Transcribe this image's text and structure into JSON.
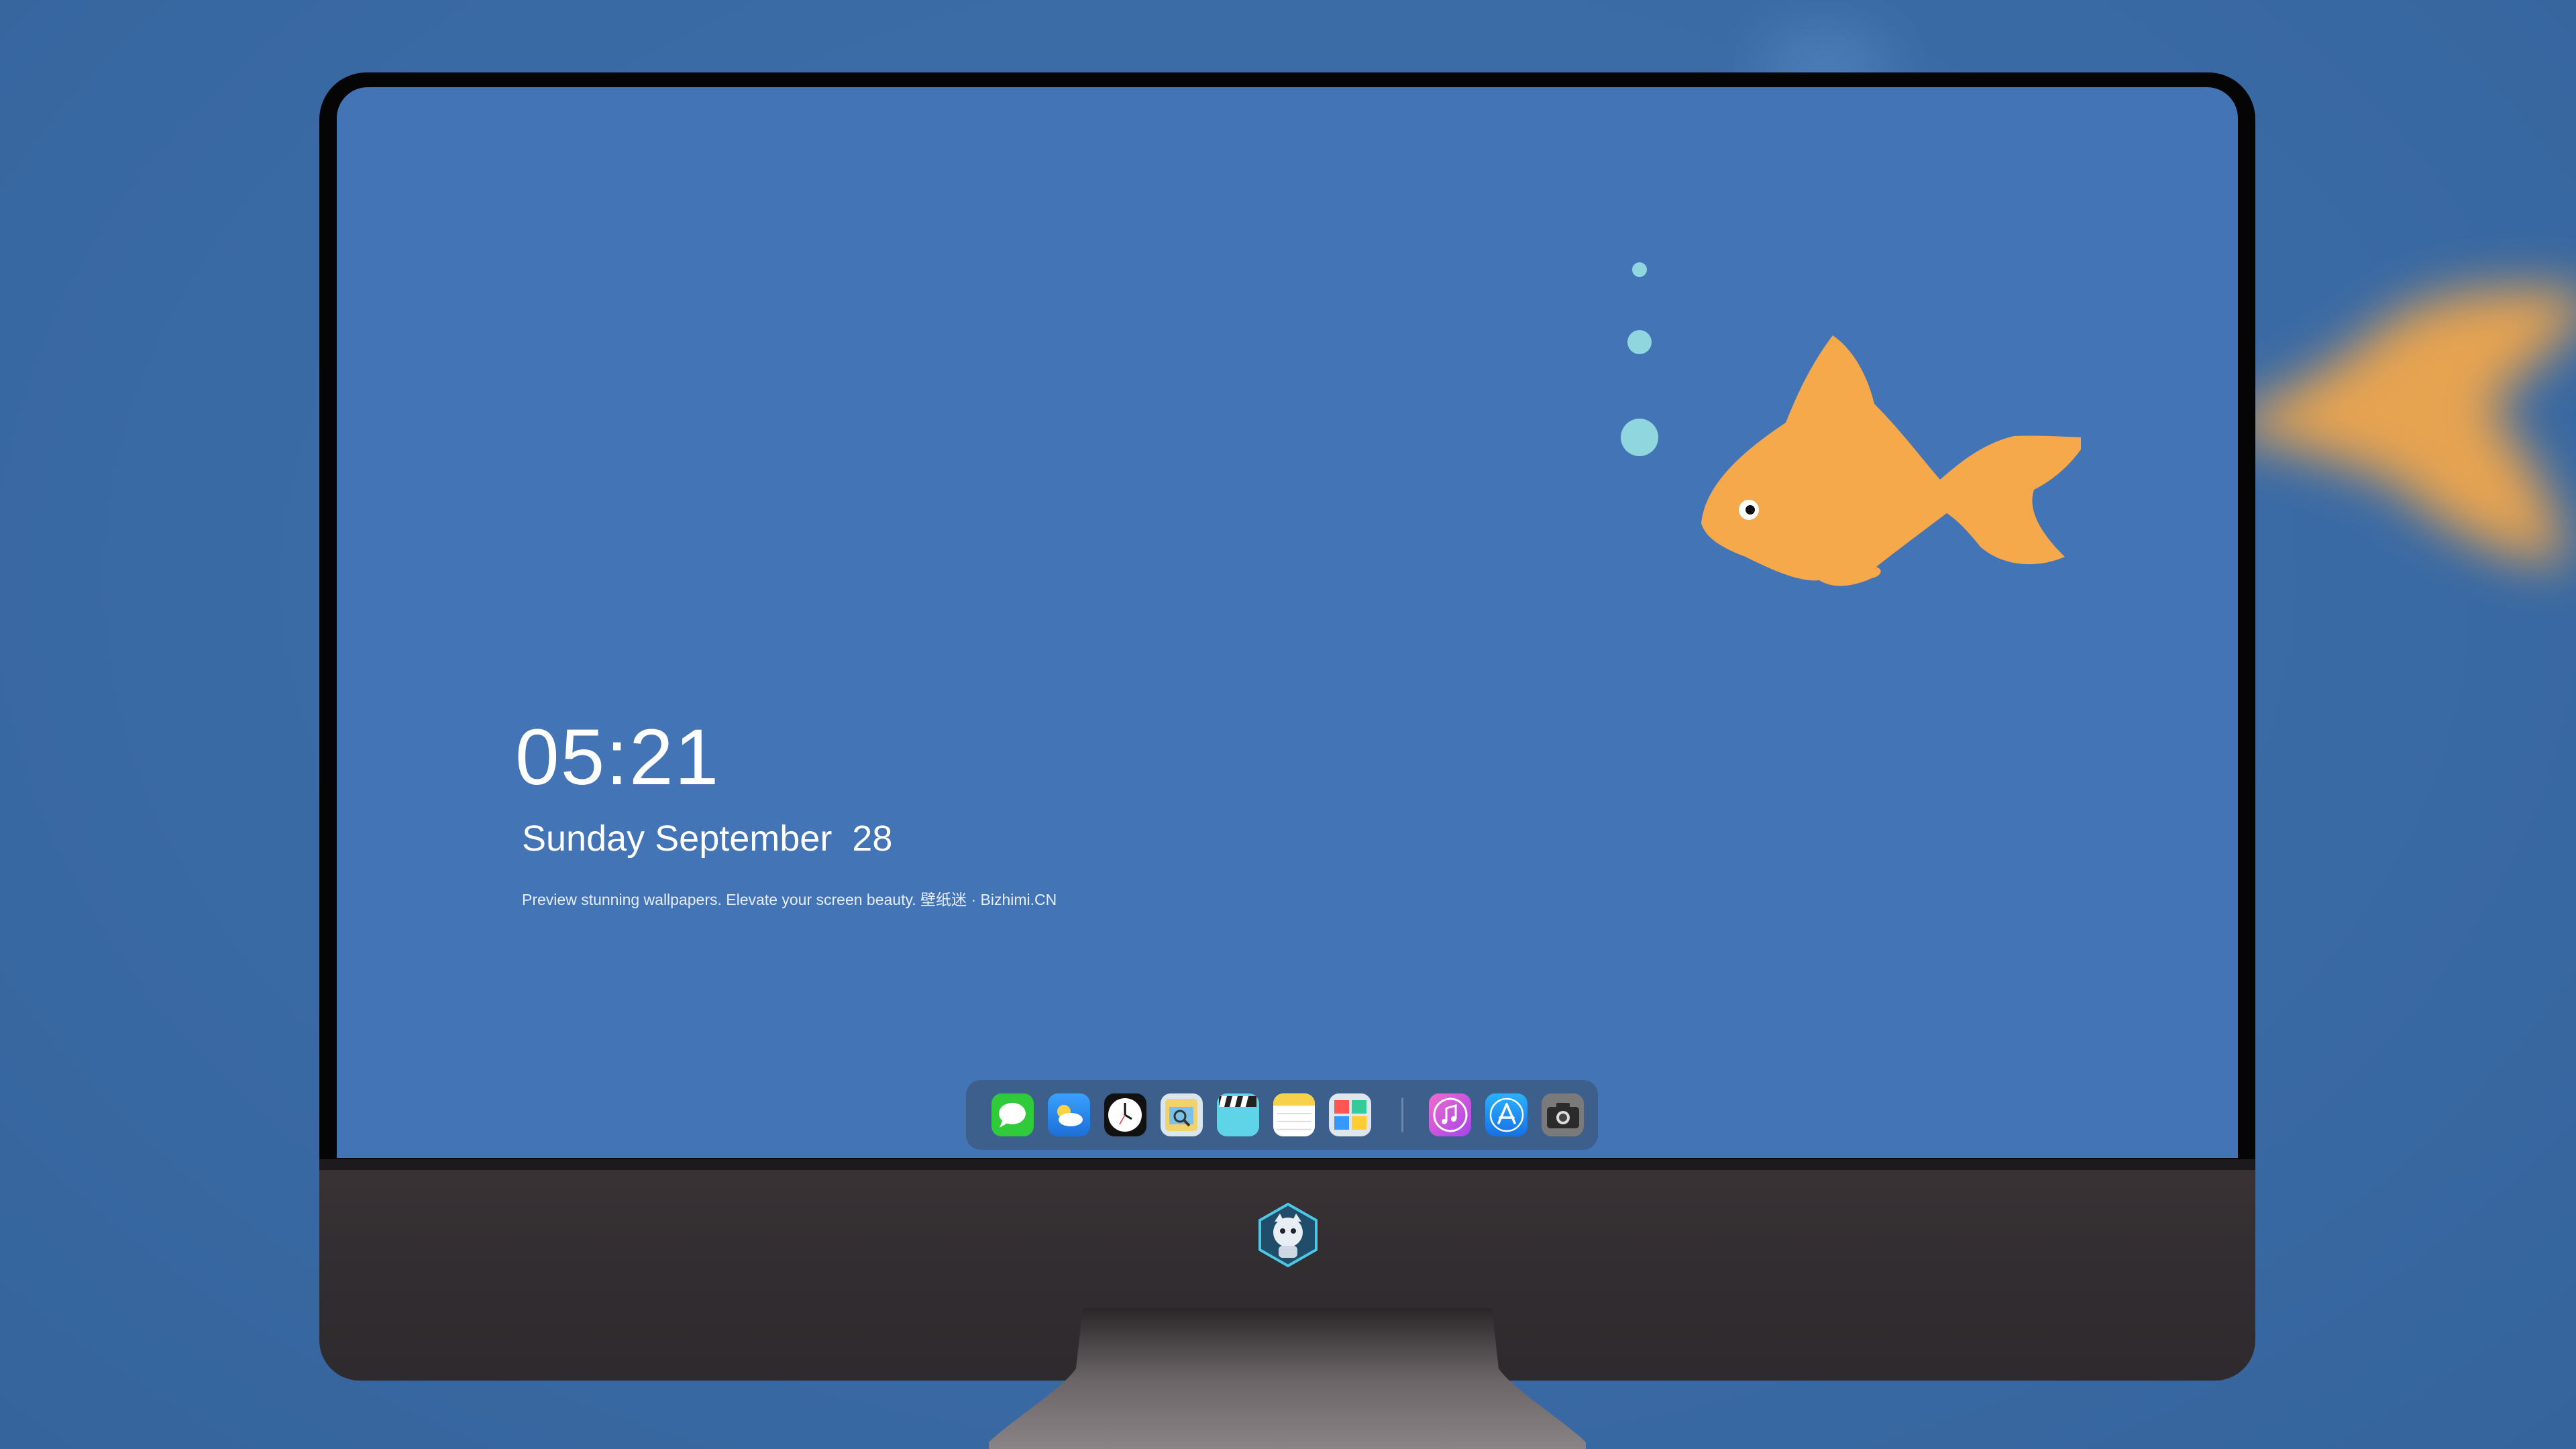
{
  "lockscreen": {
    "time": "05:21",
    "date": "Sunday September  28",
    "tagline": "Preview stunning wallpapers. Elevate your screen beauty. 壁纸迷 · Bizhimi.CN"
  },
  "dock": {
    "apps": [
      {
        "name": "Messages",
        "icon": "messages-icon",
        "color": "#2fcb3b"
      },
      {
        "name": "Weather",
        "icon": "weather-icon",
        "color": "#2b8ff0"
      },
      {
        "name": "Clock",
        "icon": "clock-icon",
        "color": "#111111"
      },
      {
        "name": "Preview",
        "icon": "preview-icon",
        "color": "#e9c45a"
      },
      {
        "name": "Clips",
        "icon": "clips-icon",
        "color": "#5fd4e8"
      },
      {
        "name": "Notes",
        "icon": "notes-icon",
        "color": "#f7d14a"
      },
      {
        "name": "Photo Booth",
        "icon": "photo-booth-icon",
        "color": "#cfd6e0"
      },
      {
        "name": "iTunes",
        "icon": "itunes-icon",
        "color": "#d457e6"
      },
      {
        "name": "App Store",
        "icon": "app-store-icon",
        "color": "#1b8ef3"
      },
      {
        "name": "Screenshot",
        "icon": "camera-icon",
        "color": "#6c6c6c"
      }
    ]
  },
  "colors": {
    "background": "#3b6ea8",
    "screen": "#4274b6",
    "fish": "#f6a94a",
    "bubbles": "#8fd6de"
  }
}
